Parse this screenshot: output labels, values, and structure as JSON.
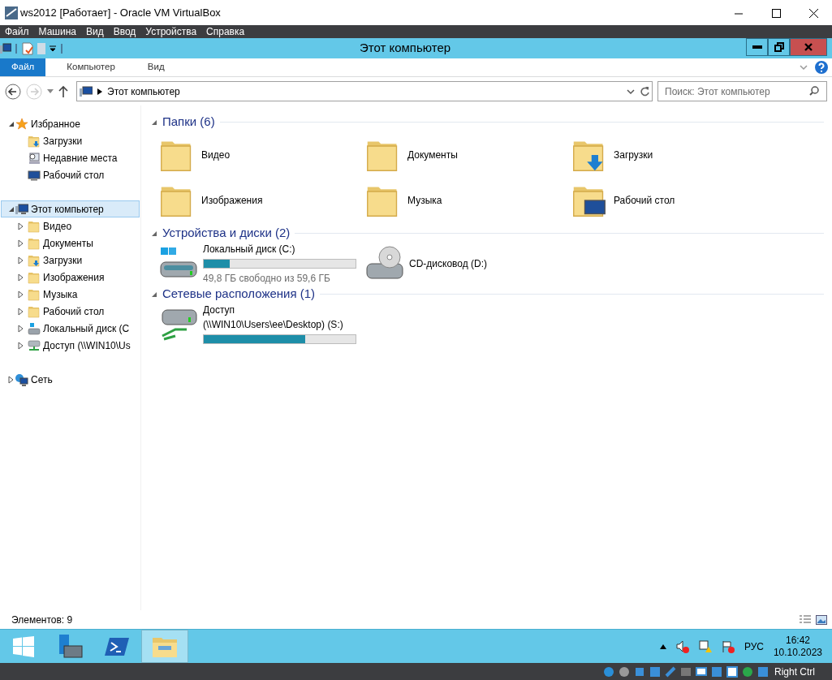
{
  "window": {
    "title": "ws2012 [Работает] - Oracle VM VirtualBox"
  },
  "menu": [
    "Файл",
    "Машина",
    "Вид",
    "Ввод",
    "Устройства",
    "Справка"
  ],
  "explorer": {
    "title": "Этот компьютер",
    "ribbon_tabs": [
      {
        "label": "Файл",
        "selected": true
      },
      {
        "label": "Компьютер",
        "selected": false
      },
      {
        "label": "Вид",
        "selected": false
      }
    ],
    "address": {
      "path": "Этот компьютер"
    },
    "search": {
      "placeholder": "Поиск: Этот компьютер"
    },
    "sidebar": [
      {
        "kind": "favorites",
        "label": "Избранное",
        "expanded": true,
        "selected": false,
        "children": [
          {
            "kind": "download",
            "label": "Загрузки",
            "selected": false
          },
          {
            "kind": "recent",
            "label": "Недавние места",
            "selected": false
          },
          {
            "kind": "desktop",
            "label": "Рабочий стол",
            "selected": false
          }
        ]
      },
      {
        "kind": "computer",
        "label": "Этот компьютер",
        "expanded": true,
        "selected": true,
        "children": [
          {
            "kind": "folder",
            "label": "Видео",
            "expanded": false,
            "selected": false
          },
          {
            "kind": "folder",
            "label": "Документы",
            "expanded": false,
            "selected": false
          },
          {
            "kind": "download",
            "label": "Загрузки",
            "expanded": false,
            "selected": false
          },
          {
            "kind": "folder",
            "label": "Изображения",
            "expanded": false,
            "selected": false
          },
          {
            "kind": "folder",
            "label": "Музыка",
            "expanded": false,
            "selected": false
          },
          {
            "kind": "folder",
            "label": "Рабочий стол",
            "expanded": false,
            "selected": false
          },
          {
            "kind": "drive",
            "label": "Локальный диск (C",
            "expanded": false,
            "selected": false
          },
          {
            "kind": "network_drive",
            "label": "Доступ (\\\\WIN10\\Us",
            "expanded": false,
            "selected": false
          }
        ]
      },
      {
        "kind": "network",
        "label": "Сеть",
        "expanded": false,
        "selected": false
      }
    ],
    "groups": [
      {
        "title": "Папки (6)",
        "expanded": true,
        "items": [
          {
            "kind": "folder",
            "name": "Видео"
          },
          {
            "kind": "folder",
            "name": "Документы"
          },
          {
            "kind": "download",
            "name": "Загрузки"
          },
          {
            "kind": "folder",
            "name": "Изображения"
          },
          {
            "kind": "folder",
            "name": "Музыка"
          },
          {
            "kind": "desktop",
            "name": "Рабочий стол"
          }
        ]
      },
      {
        "title": "Устройства и диски (2)",
        "expanded": true,
        "items": [
          {
            "kind": "drive",
            "name": "Локальный диск (C:)",
            "level": 0.17,
            "info": "49,8 ГБ свободно из 59,6 ГБ"
          },
          {
            "kind": "cd",
            "name": "CD-дисковод (D:)"
          }
        ]
      },
      {
        "title": "Сетевые расположения (1)",
        "expanded": true,
        "items": [
          {
            "kind": "network_drive",
            "name": "Доступ",
            "subtitle": "(\\\\WIN10\\Users\\ee\\Desktop) (S:)",
            "level": 0.67
          }
        ]
      }
    ],
    "status": "Элементов: 9"
  },
  "taskbar": {
    "apps": [
      {
        "kind": "server",
        "selected": false
      },
      {
        "kind": "powershell",
        "selected": false
      },
      {
        "kind": "explorer",
        "selected": true
      }
    ],
    "language": "РУС",
    "time": "16:42",
    "date": "10.10.2023"
  },
  "vbox_status": {
    "host_key": "Right Ctrl"
  }
}
